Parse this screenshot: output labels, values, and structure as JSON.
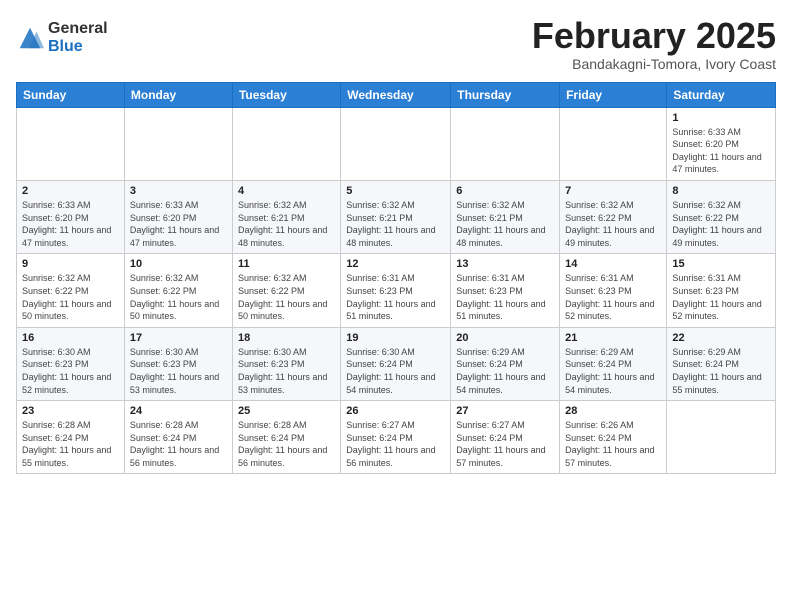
{
  "logo": {
    "general": "General",
    "blue": "Blue"
  },
  "title": "February 2025",
  "location": "Bandakagni-Tomora, Ivory Coast",
  "days_of_week": [
    "Sunday",
    "Monday",
    "Tuesday",
    "Wednesday",
    "Thursday",
    "Friday",
    "Saturday"
  ],
  "weeks": [
    [
      {
        "day": "",
        "info": ""
      },
      {
        "day": "",
        "info": ""
      },
      {
        "day": "",
        "info": ""
      },
      {
        "day": "",
        "info": ""
      },
      {
        "day": "",
        "info": ""
      },
      {
        "day": "",
        "info": ""
      },
      {
        "day": "1",
        "info": "Sunrise: 6:33 AM\nSunset: 6:20 PM\nDaylight: 11 hours and 47 minutes."
      }
    ],
    [
      {
        "day": "2",
        "info": "Sunrise: 6:33 AM\nSunset: 6:20 PM\nDaylight: 11 hours and 47 minutes."
      },
      {
        "day": "3",
        "info": "Sunrise: 6:33 AM\nSunset: 6:20 PM\nDaylight: 11 hours and 47 minutes."
      },
      {
        "day": "4",
        "info": "Sunrise: 6:32 AM\nSunset: 6:21 PM\nDaylight: 11 hours and 48 minutes."
      },
      {
        "day": "5",
        "info": "Sunrise: 6:32 AM\nSunset: 6:21 PM\nDaylight: 11 hours and 48 minutes."
      },
      {
        "day": "6",
        "info": "Sunrise: 6:32 AM\nSunset: 6:21 PM\nDaylight: 11 hours and 48 minutes."
      },
      {
        "day": "7",
        "info": "Sunrise: 6:32 AM\nSunset: 6:22 PM\nDaylight: 11 hours and 49 minutes."
      },
      {
        "day": "8",
        "info": "Sunrise: 6:32 AM\nSunset: 6:22 PM\nDaylight: 11 hours and 49 minutes."
      }
    ],
    [
      {
        "day": "9",
        "info": "Sunrise: 6:32 AM\nSunset: 6:22 PM\nDaylight: 11 hours and 50 minutes."
      },
      {
        "day": "10",
        "info": "Sunrise: 6:32 AM\nSunset: 6:22 PM\nDaylight: 11 hours and 50 minutes."
      },
      {
        "day": "11",
        "info": "Sunrise: 6:32 AM\nSunset: 6:22 PM\nDaylight: 11 hours and 50 minutes."
      },
      {
        "day": "12",
        "info": "Sunrise: 6:31 AM\nSunset: 6:23 PM\nDaylight: 11 hours and 51 minutes."
      },
      {
        "day": "13",
        "info": "Sunrise: 6:31 AM\nSunset: 6:23 PM\nDaylight: 11 hours and 51 minutes."
      },
      {
        "day": "14",
        "info": "Sunrise: 6:31 AM\nSunset: 6:23 PM\nDaylight: 11 hours and 52 minutes."
      },
      {
        "day": "15",
        "info": "Sunrise: 6:31 AM\nSunset: 6:23 PM\nDaylight: 11 hours and 52 minutes."
      }
    ],
    [
      {
        "day": "16",
        "info": "Sunrise: 6:30 AM\nSunset: 6:23 PM\nDaylight: 11 hours and 52 minutes."
      },
      {
        "day": "17",
        "info": "Sunrise: 6:30 AM\nSunset: 6:23 PM\nDaylight: 11 hours and 53 minutes."
      },
      {
        "day": "18",
        "info": "Sunrise: 6:30 AM\nSunset: 6:23 PM\nDaylight: 11 hours and 53 minutes."
      },
      {
        "day": "19",
        "info": "Sunrise: 6:30 AM\nSunset: 6:24 PM\nDaylight: 11 hours and 54 minutes."
      },
      {
        "day": "20",
        "info": "Sunrise: 6:29 AM\nSunset: 6:24 PM\nDaylight: 11 hours and 54 minutes."
      },
      {
        "day": "21",
        "info": "Sunrise: 6:29 AM\nSunset: 6:24 PM\nDaylight: 11 hours and 54 minutes."
      },
      {
        "day": "22",
        "info": "Sunrise: 6:29 AM\nSunset: 6:24 PM\nDaylight: 11 hours and 55 minutes."
      }
    ],
    [
      {
        "day": "23",
        "info": "Sunrise: 6:28 AM\nSunset: 6:24 PM\nDaylight: 11 hours and 55 minutes."
      },
      {
        "day": "24",
        "info": "Sunrise: 6:28 AM\nSunset: 6:24 PM\nDaylight: 11 hours and 56 minutes."
      },
      {
        "day": "25",
        "info": "Sunrise: 6:28 AM\nSunset: 6:24 PM\nDaylight: 11 hours and 56 minutes."
      },
      {
        "day": "26",
        "info": "Sunrise: 6:27 AM\nSunset: 6:24 PM\nDaylight: 11 hours and 56 minutes."
      },
      {
        "day": "27",
        "info": "Sunrise: 6:27 AM\nSunset: 6:24 PM\nDaylight: 11 hours and 57 minutes."
      },
      {
        "day": "28",
        "info": "Sunrise: 6:26 AM\nSunset: 6:24 PM\nDaylight: 11 hours and 57 minutes."
      },
      {
        "day": "",
        "info": ""
      }
    ]
  ]
}
